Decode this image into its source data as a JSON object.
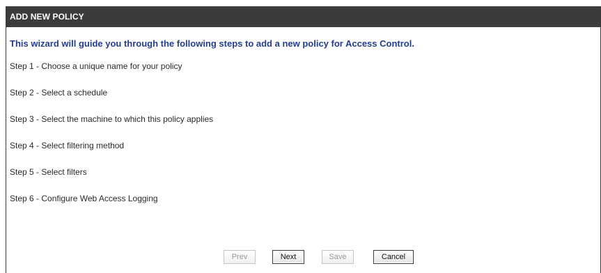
{
  "panel": {
    "title": "ADD NEW POLICY",
    "intro": "This wizard will guide you through the following steps to add a new policy for Access Control.",
    "steps": [
      "Step 1 - Choose a unique name for your policy",
      "Step 2 - Select a schedule",
      "Step 3 - Select the machine to which this policy applies",
      "Step 4 - Select filtering method",
      "Step 5 - Select filters",
      "Step 6 - Configure Web Access Logging"
    ]
  },
  "buttons": {
    "prev": "Prev",
    "next": "Next",
    "save": "Save",
    "cancel": "Cancel"
  },
  "colors": {
    "title_bar": "#3b3b3b",
    "intro_text": "#243e8e"
  }
}
